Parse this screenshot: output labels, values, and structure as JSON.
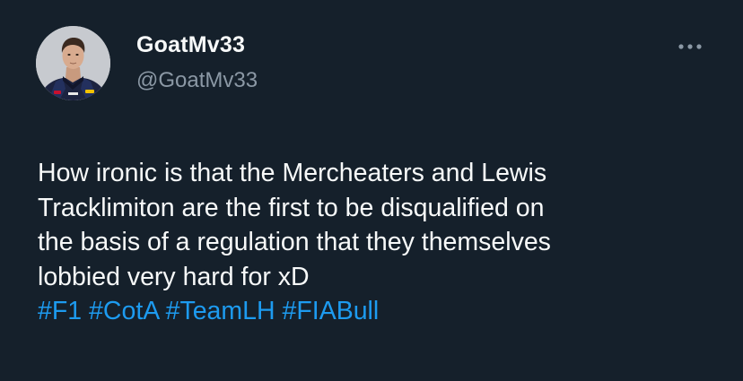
{
  "author": {
    "display_name": "GoatMv33",
    "handle": "@GoatMv33",
    "avatar_icon": "driver-portrait-avatar"
  },
  "more_icon": "more-horizontal-icon",
  "tweet": {
    "lines": [
      "How ironic is that the Mercheaters and Lewis",
      "Tracklimiton are the first to be disqualified on",
      "the basis of a regulation that they themselves",
      "lobbied very hard for xD"
    ],
    "hashtags": [
      "#F1",
      "#CotA",
      "#TeamLH",
      "#FIABull"
    ]
  },
  "colors": {
    "background": "#15202b",
    "text": "#f7f9f9",
    "secondary": "#8b98a5",
    "link": "#1d9bf0"
  }
}
